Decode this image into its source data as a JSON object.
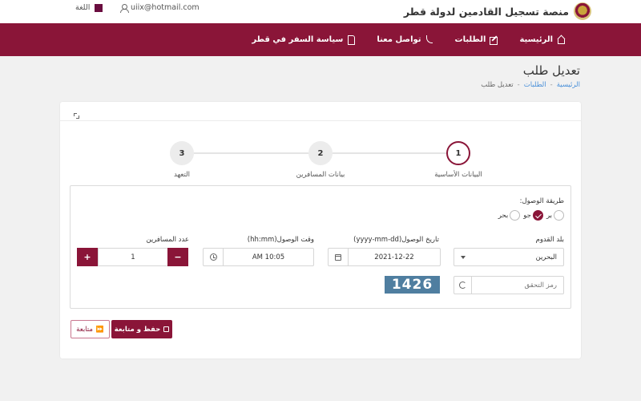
{
  "header": {
    "brand_title": "منصة تسجيل القادمين لدولة قطر",
    "email": "uiix@hotmail.com",
    "language_label": "اللغة",
    "colors": {
      "brand": "#8a1538",
      "language_swatch": "#6a0d3f"
    }
  },
  "nav": {
    "items": [
      {
        "label": "الرئيسية",
        "icon": "home-icon"
      },
      {
        "label": "الطلبات",
        "icon": "edit-icon"
      },
      {
        "label": "تواصل معنا",
        "icon": "phone-icon"
      },
      {
        "label": "سياسة السفر في قطر",
        "icon": "document-icon"
      }
    ]
  },
  "page": {
    "title": "تعديل طلب",
    "breadcrumb": [
      "الرئيسية",
      "الطلبات",
      "تعديل طلب"
    ],
    "breadcrumb_separator": "-"
  },
  "stepper": {
    "steps": [
      {
        "number": "1",
        "label": "البيانات الأساسية",
        "active": true
      },
      {
        "number": "2",
        "label": "بيانات المسافرين",
        "active": false
      },
      {
        "number": "3",
        "label": "التعهد",
        "active": false
      }
    ]
  },
  "form": {
    "arrival_method": {
      "label": "طريقة الوصول:",
      "options": [
        {
          "label": "بر",
          "checked": false
        },
        {
          "label": "جو",
          "checked": true
        },
        {
          "label": "بحر",
          "checked": false
        }
      ]
    },
    "arrival_country": {
      "label": "بلد القدوم",
      "value": "البحرين"
    },
    "arrival_date": {
      "label": "تاريخ الوصول(yyyy-mm-dd)",
      "value": "2021-12-22"
    },
    "arrival_time": {
      "label": "وقت الوصول(hh:mm)",
      "value": "AM 10:05"
    },
    "travelers_count": {
      "label": "عدد المسافرين",
      "value": "1",
      "minus": "−",
      "plus": "+"
    },
    "captcha": {
      "placeholder": "رمز التحقق",
      "code": "1426"
    }
  },
  "actions": {
    "save_continue": "حفظ و متابعة",
    "continue": "متابعة"
  }
}
